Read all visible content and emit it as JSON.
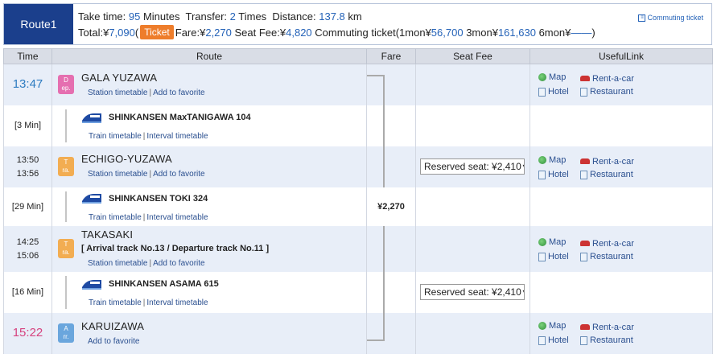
{
  "summary": {
    "route_label": "Route1",
    "take_time_label": "Take time:",
    "take_time_value": "95",
    "minutes_label": "Minutes",
    "transfer_label": "Transfer:",
    "transfer_value": "2",
    "times_label": "Times",
    "distance_label": "Distance:",
    "distance_value": "137.8",
    "km_label": "km",
    "total_label": "Total:¥",
    "total_value": "7,090",
    "open_paren": "(",
    "ticket_button": "Ticket",
    "fare_label": "Fare:¥",
    "fare_value": "2,270",
    "seat_fee_label": "Seat Fee:¥",
    "seat_fee_value": "4,820",
    "commuting_label": "Commuting ticket(1mon¥",
    "mon1_value": "56,700",
    "mon3_label": "3mon¥",
    "mon3_value": "161,630",
    "mon6_label": "6mon¥",
    "mon6_value": "——",
    "close_paren": ")",
    "commuting_link": "Commuting ticket"
  },
  "columns": {
    "time": "Time",
    "route": "Route",
    "fare": "Fare",
    "seat_fee": "Seat Fee",
    "useful_link": "UsefulLink"
  },
  "links": {
    "map": "Map",
    "rent_a_car": "Rent-a-car",
    "hotel": "Hotel",
    "restaurant": "Restaurant",
    "station_timetable": "Station timetable",
    "add_to_favorite": "Add to favorite",
    "train_timetable": "Train timetable",
    "interval_timetable": "Interval timetable",
    "separator": "|"
  },
  "stations": [
    {
      "time": "13:47",
      "icon_top": "D",
      "icon_bottom": "ep.",
      "name": "GALA YUZAWA"
    },
    {
      "time_arr": "13:50",
      "time_dep": "13:56",
      "icon_top": "T",
      "icon_bottom": "ra.",
      "name": "ECHIGO-YUZAWA"
    },
    {
      "time_arr": "14:25",
      "time_dep": "15:06",
      "icon_top": "T",
      "icon_bottom": "ra.",
      "name": "TAKASAKI",
      "track": "[ Arrival track No.13 / Departure track No.11 ]"
    },
    {
      "time": "15:22",
      "icon_top": "A",
      "icon_bottom": "rr.",
      "name": "KARUIZAWA"
    }
  ],
  "trains": [
    {
      "duration": "[3 Min]",
      "name": "SHINKANSEN MaxTANIGAWA 104"
    },
    {
      "duration": "[29 Min]",
      "name": "SHINKANSEN TOKI 324"
    },
    {
      "duration": "[16 Min]",
      "name": "SHINKANSEN ASAMA 615"
    }
  ],
  "fare_amount": "¥2,270",
  "seat_select_text": "Reserved seat: ¥2,410",
  "seat_arrow": "▼",
  "colors": {
    "route_badge": "#1b3f8c",
    "ticket_button": "#ee7d2b",
    "dep_time": "#2e7cc1",
    "arr_time": "#d6437f"
  }
}
